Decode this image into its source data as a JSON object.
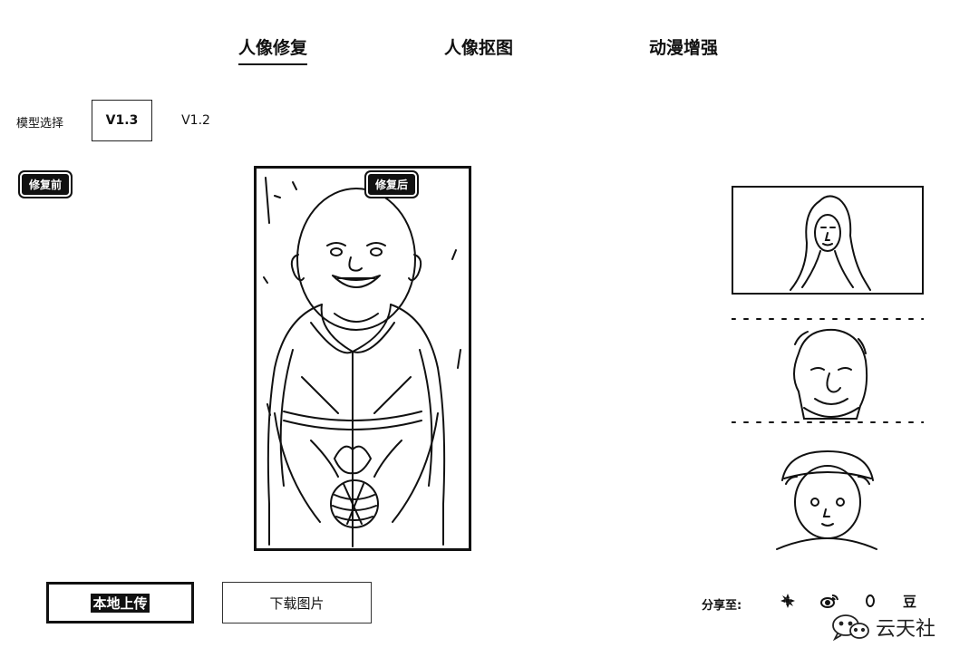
{
  "tabs": [
    {
      "label": "人像修复",
      "active": true
    },
    {
      "label": "人像抠图",
      "active": false
    },
    {
      "label": "动漫增强",
      "active": false
    }
  ],
  "model": {
    "label": "模型选择",
    "options": [
      "V1.3",
      "V1.2"
    ],
    "selected": "V1.3"
  },
  "preview": {
    "before_tag": "修复前",
    "after_tag": "修复后"
  },
  "thumbnails": [
    {
      "icon": "woman-portrait"
    },
    {
      "icon": "old-man-portrait"
    },
    {
      "icon": "child-portrait"
    }
  ],
  "actions": {
    "upload_label": "本地上传",
    "download_label": "下载图片"
  },
  "share": {
    "label": "分享至:",
    "icons": [
      "moments-icon",
      "weibo-icon",
      "qq-icon",
      "douban-icon"
    ],
    "douban_glyph": "豆"
  },
  "watermark": {
    "text": "云天社"
  }
}
